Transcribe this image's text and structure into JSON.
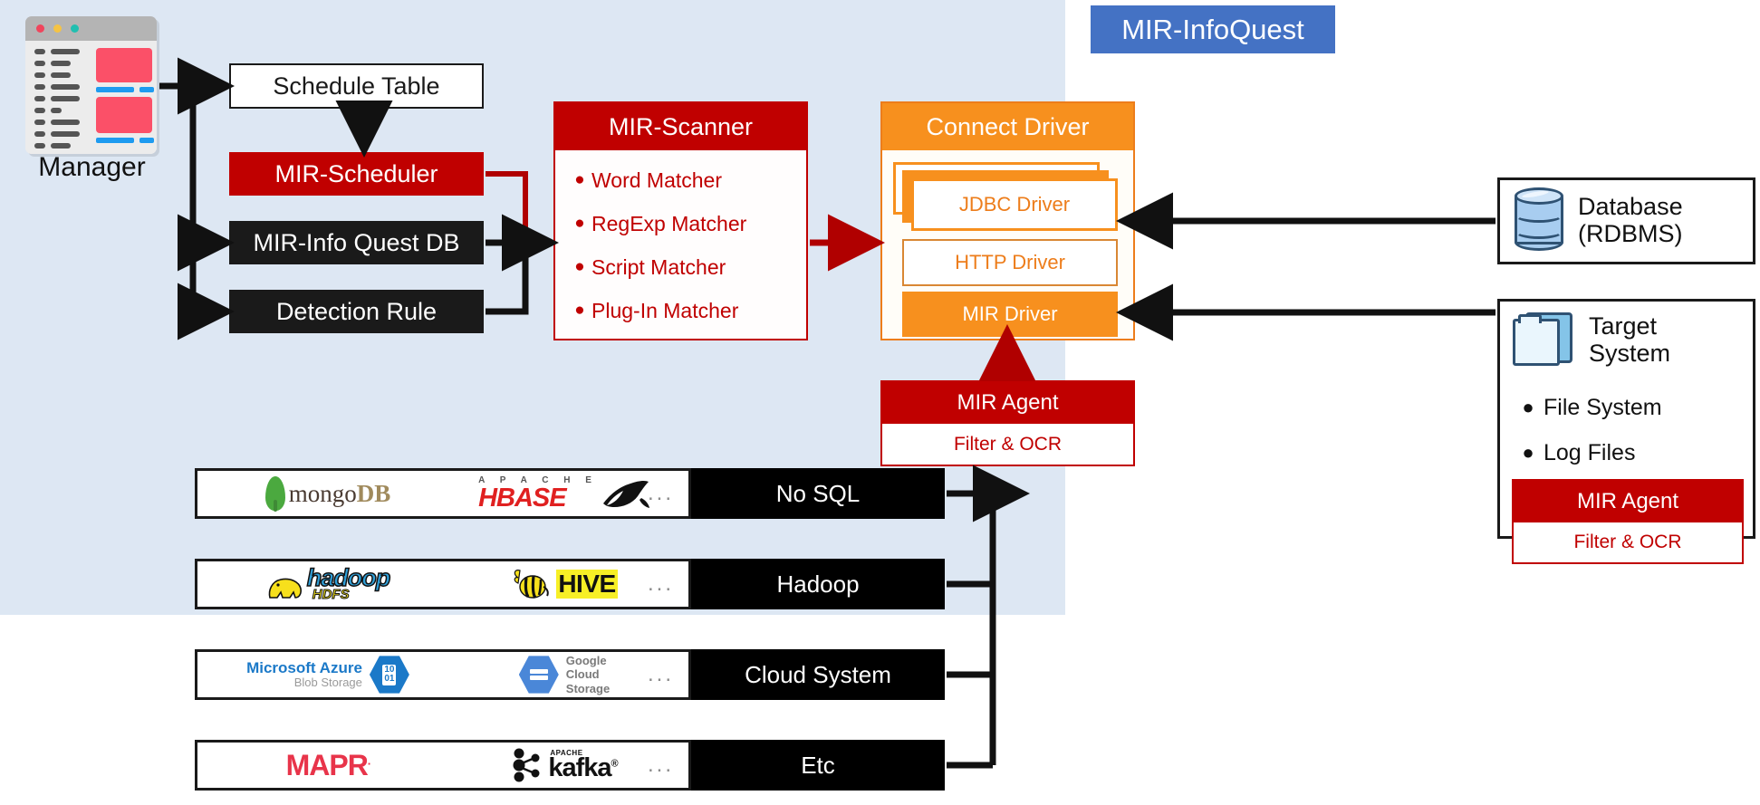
{
  "panel": {
    "title": "MIR-InfoQuest",
    "accent_blue": "#4472c4",
    "panel_bg": "#dde7f3"
  },
  "manager": {
    "label": "Manager",
    "icon": "browser-window-icon"
  },
  "left_blocks": {
    "schedule_table": "Schedule Table",
    "mir_scheduler": "MIR-Scheduler",
    "mir_infoquest_db": "MIR-Info Quest DB",
    "detection_rule": "Detection Rule"
  },
  "scanner": {
    "title": "MIR-Scanner",
    "accent": "#c00000",
    "items": [
      "Word Matcher",
      "RegExp Matcher",
      "Script Matcher",
      "Plug-In Matcher"
    ]
  },
  "connect_driver": {
    "title": "Connect Driver",
    "accent": "#f7901e",
    "drivers": [
      {
        "label": "JDBC Driver",
        "style": "stacked"
      },
      {
        "label": "HTTP Driver",
        "style": "outline"
      },
      {
        "label": "MIR Driver",
        "style": "filled"
      }
    ]
  },
  "mir_agent_panel": {
    "title": "MIR Agent",
    "subtitle": "Filter & OCR",
    "accent": "#c00000"
  },
  "database_card": {
    "icon": "database-cylinder-icon",
    "line1": "Database",
    "line2": "(RDBMS)"
  },
  "target_system_card": {
    "icon": "folders-icon",
    "title_line1": "Target",
    "title_line2": "System",
    "bullets": [
      "File System",
      "Log Files"
    ],
    "agent": {
      "title": "MIR Agent",
      "subtitle": "Filter & OCR"
    }
  },
  "source_rows": [
    {
      "category": "No SQL",
      "logos": [
        "mongoDB",
        "APACHE HBASE"
      ],
      "overflow": "..."
    },
    {
      "category": "Hadoop",
      "logos": [
        "hadoop HDFS",
        "HIVE"
      ],
      "overflow": "..."
    },
    {
      "category": "Cloud System",
      "logos": [
        "Microsoft Azure Blob Storage",
        "Google Cloud Storage"
      ],
      "overflow": "..."
    },
    {
      "category": "Etc",
      "logos": [
        "MAPR",
        "APACHE kafka"
      ],
      "overflow": "..."
    }
  ],
  "logo_text": {
    "mongo_first": "mongo",
    "mongo_second": "DB",
    "hbase_apache": "A P A C H E",
    "hbase_main": "HBASE",
    "hadoop_main": "hadoop",
    "hadoop_sub": "HDFS",
    "hive_main": "HIVE",
    "azure_line1": "Microsoft Azure",
    "azure_line2": "Blob Storage",
    "azure_hex": "10\n01",
    "gcs_line1": "Google",
    "gcs_line2": "Cloud",
    "gcs_line3": "Storage",
    "mapr_main": "MAPR",
    "mapr_dot": ".",
    "kafka_apache": "APACHE",
    "kafka_main": "kafka",
    "kafka_reg": "®"
  }
}
